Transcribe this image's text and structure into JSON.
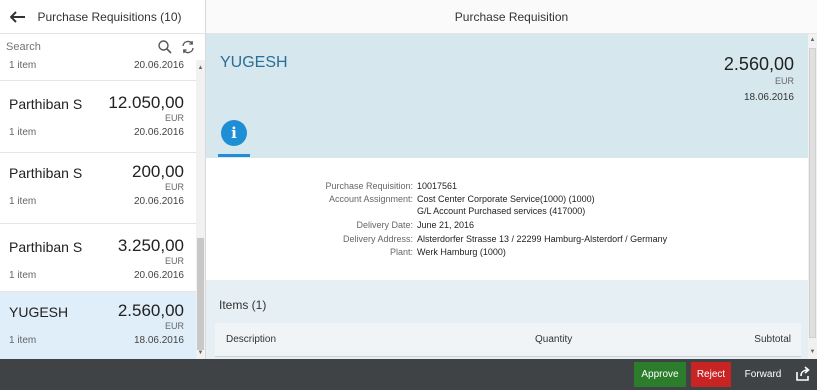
{
  "master": {
    "title": "Purchase Requisitions (10)",
    "search_placeholder": "Search",
    "partial_item": {
      "items": "1 item",
      "date": "20.06.2016"
    },
    "items": [
      {
        "name": "Parthiban S",
        "amount": "12.050,00",
        "currency": "EUR",
        "items": "1 item",
        "date": "20.06.2016"
      },
      {
        "name": "Parthiban S",
        "amount": "200,00",
        "currency": "EUR",
        "items": "1 item",
        "date": "20.06.2016"
      },
      {
        "name": "Parthiban S",
        "amount": "3.250,00",
        "currency": "EUR",
        "items": "1 item",
        "date": "20.06.2016"
      },
      {
        "name": "YUGESH",
        "amount": "2.560,00",
        "currency": "EUR",
        "items": "1 item",
        "date": "18.06.2016"
      }
    ]
  },
  "detail": {
    "title": "Purchase Requisition",
    "header": {
      "name": "YUGESH",
      "amount": "2.560,00",
      "currency": "EUR",
      "date": "18.06.2016"
    },
    "info_icon": "i",
    "form": [
      {
        "label": "Purchase Requisition:",
        "value": "10017561"
      },
      {
        "label": "Account Assignment:",
        "value": "Cost Center Corporate Service(1000) (1000)",
        "value2": "G/L Account Purchased services (417000)"
      },
      {
        "label": "Delivery Date:",
        "value": "June 21, 2016"
      },
      {
        "label": "Delivery Address:",
        "value": "Alsterdorfer Strasse 13 / 22299 Hamburg-Alsterdorf / Germany"
      },
      {
        "label": "Plant:",
        "value": "Werk Hamburg (1000)"
      }
    ],
    "items": {
      "title": "Items (1)",
      "columns": {
        "description": "Description",
        "quantity": "Quantity",
        "subtotal": "Subtotal"
      }
    }
  },
  "footer": {
    "approve": "Approve",
    "reject": "Reject",
    "forward": "Forward"
  },
  "colors": {
    "accent": "#1f8fd5",
    "approve": "#2b7c2b",
    "reject": "#c92424",
    "footer": "#3f4346",
    "selected": "#dfeef8"
  }
}
